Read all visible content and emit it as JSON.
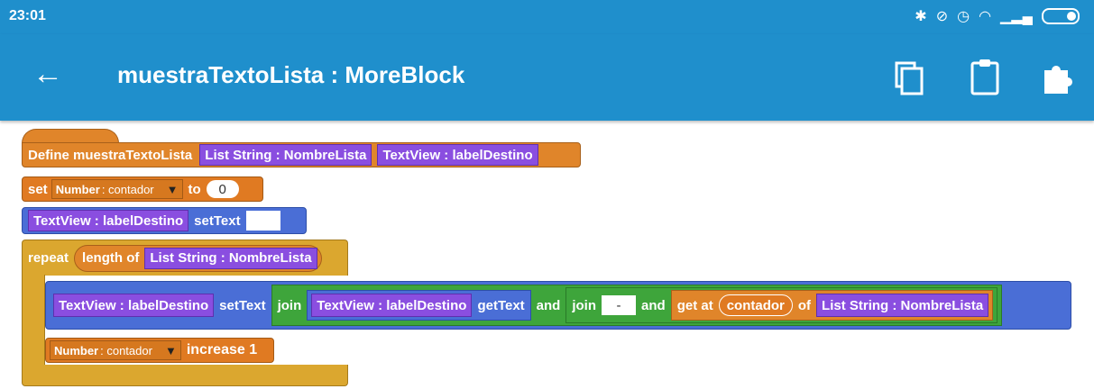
{
  "status": {
    "time": "23:01",
    "icons": [
      "bluetooth-icon",
      "mute-icon",
      "alarm-icon",
      "wifi-icon",
      "signal-icon",
      "battery-icon"
    ]
  },
  "appbar": {
    "back_icon": "arrow-left-icon",
    "title": "muestraTextoLista : MoreBlock",
    "actions": [
      "copy-icon",
      "clipboard-icon",
      "puzzle-icon"
    ]
  },
  "blocks": {
    "define": {
      "label": "Define muestraTextoLista",
      "param1": "List String : NombreLista",
      "param2": "TextView : labelDestino"
    },
    "set": {
      "set": "set",
      "var_type": "Number",
      "var_name": ": contador",
      "to": "to",
      "value": "0"
    },
    "settext1": {
      "view": "TextView : labelDestino",
      "method": "setText",
      "value": ""
    },
    "repeat": {
      "label": "repeat",
      "length_of": "length of",
      "list": "List String : NombreLista"
    },
    "settext2": {
      "view": "TextView : labelDestino",
      "method": "setText",
      "join1": "join",
      "view2": "TextView : labelDestino",
      "get_text": "getText",
      "and1": "and",
      "join2": "join",
      "sep": "-",
      "and2": "and",
      "get_at": "get at",
      "index": "contador",
      "of": "of",
      "list": "List String : NombreLista"
    },
    "increase": {
      "var_type": "Number",
      "var_name": ": contador",
      "label": "increase 1"
    }
  },
  "colors": {
    "appbar": "#1f8fcc",
    "event": "#e0852a",
    "view": "#4a6ed6",
    "param": "#8a4ee0",
    "control": "#dba72f",
    "operator": "#3ea53b"
  }
}
